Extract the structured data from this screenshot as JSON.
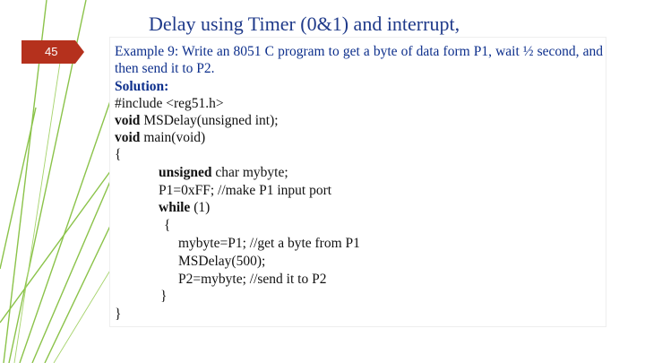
{
  "title": "Delay using Timer (0&1) and interrupt,",
  "slide_number": "45",
  "example_text": "Example 9: Write an 8051 C program to get a byte of data form P1, wait ½ second, and then send it to P2.",
  "solution_label": "Solution:",
  "code": {
    "l1": "#include <reg51.h>",
    "l2_kw": "void",
    "l2_rest": " MSDelay(unsigned int);",
    "l3_kw": "void",
    "l3_rest": " main(void)",
    "l4": "{",
    "l5_kw": "unsigned",
    "l5_rest": " char mybyte;",
    "l6": "P1=0xFF; //make P1 input port",
    "l7_kw": "while",
    "l7_rest": " (1)",
    "l8": "{",
    "l9": "mybyte=P1; //get a byte from P1",
    "l10": "MSDelay(500);",
    "l11": "P2=mybyte; //send it to P2",
    "l12": "}",
    "l13": "}"
  },
  "colors": {
    "accent": "#b5311d",
    "title": "#1f3a8a",
    "deco_lines": "#8bc34a"
  }
}
